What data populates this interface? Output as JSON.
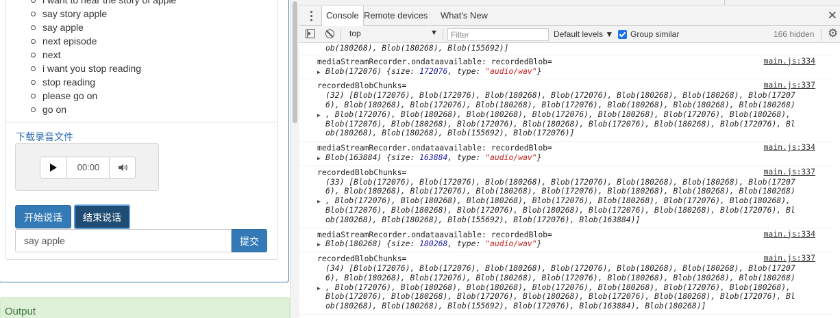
{
  "left": {
    "commands": [
      "i want to hear the story of apple",
      "say story apple",
      "say apple",
      "next episode",
      "next",
      "i want you stop reading",
      "stop reading",
      "please go on",
      "go on"
    ],
    "download_link": "下载录音文件",
    "audio": {
      "time": "00:00"
    },
    "start_button": "开始说话",
    "stop_button": "结束说话",
    "input_value": "say apple",
    "submit_button": "提交",
    "output_title": "Output"
  },
  "devtools": {
    "tabs": [
      "Console",
      "Remote devices",
      "What's New"
    ],
    "context": "top",
    "filter_placeholder": "Filter",
    "levels": "Default levels ▼",
    "group_similar": "Group similar",
    "group_similar_checked": true,
    "hidden_count": "166 hidden",
    "accent_color": "#1a73e8",
    "messages": [
      {
        "type": "cont",
        "lines": [
          "ob(180268), Blob(180268), Blob(155692)]"
        ]
      },
      {
        "type": "ondata",
        "label": "mediaStreamRecorder.ondataavailable: recordedBlob=",
        "src": "main.js:334",
        "blob": "Blob(172076)",
        "size": "172076",
        "mime": "\"audio/wav\""
      },
      {
        "type": "chunks",
        "label": "recordedBlobChunks=",
        "src": "main.js:337",
        "lines": [
          "(32) [Blob(172076), Blob(172076), Blob(180268), Blob(172076), Blob(180268), Blob(180268), Blob(17207",
          "6), Blob(180268), Blob(172076), Blob(180268), Blob(172076), Blob(180268), Blob(180268), Blob(180268)",
          ", Blob(172076), Blob(180268), Blob(180268), Blob(172076), Blob(180268), Blob(172076), Blob(180268),",
          "Blob(172076), Blob(180268), Blob(172076), Blob(180268), Blob(172076), Blob(180268), Blob(172076), Bl",
          "ob(180268), Blob(180268), Blob(155692), Blob(172076)]"
        ]
      },
      {
        "type": "ondata",
        "label": "mediaStreamRecorder.ondataavailable: recordedBlob=",
        "src": "main.js:334",
        "blob": "Blob(163884)",
        "size": "163884",
        "mime": "\"audio/wav\""
      },
      {
        "type": "chunks",
        "label": "recordedBlobChunks=",
        "src": "main.js:337",
        "lines": [
          "(33) [Blob(172076), Blob(172076), Blob(180268), Blob(172076), Blob(180268), Blob(180268), Blob(17207",
          "6), Blob(180268), Blob(172076), Blob(180268), Blob(172076), Blob(180268), Blob(180268), Blob(180268)",
          ", Blob(172076), Blob(180268), Blob(180268), Blob(172076), Blob(180268), Blob(172076), Blob(180268),",
          "Blob(172076), Blob(180268), Blob(172076), Blob(180268), Blob(172076), Blob(180268), Blob(172076), Bl",
          "ob(180268), Blob(180268), Blob(155692), Blob(172076), Blob(163884)]"
        ]
      },
      {
        "type": "ondata",
        "label": "mediaStreamRecorder.ondataavailable: recordedBlob=",
        "src": "main.js:334",
        "blob": "Blob(180268)",
        "size": "180268",
        "mime": "\"audio/wav\""
      },
      {
        "type": "chunks",
        "label": "recordedBlobChunks=",
        "src": "main.js:337",
        "lines": [
          "(34) [Blob(172076), Blob(172076), Blob(180268), Blob(172076), Blob(180268), Blob(180268), Blob(17207",
          "6), Blob(180268), Blob(172076), Blob(180268), Blob(172076), Blob(180268), Blob(180268), Blob(180268)",
          ", Blob(172076), Blob(180268), Blob(180268), Blob(172076), Blob(180268), Blob(172076), Blob(180268),",
          "Blob(172076), Blob(180268), Blob(172076), Blob(180268), Blob(172076), Blob(180268), Blob(172076), Bl",
          "ob(180268), Blob(180268), Blob(155692), Blob(172076), Blob(163884), Blob(180268)]"
        ]
      }
    ],
    "prompt": "›"
  }
}
